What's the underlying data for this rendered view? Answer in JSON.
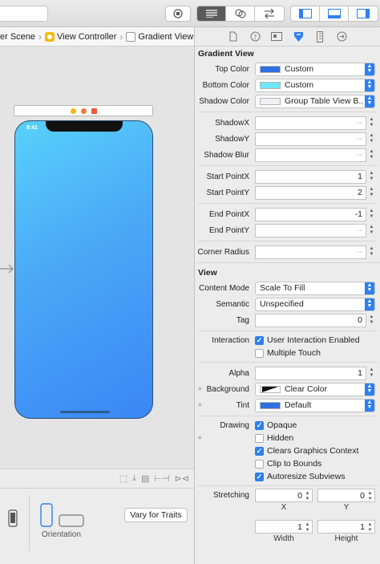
{
  "breadcrumb": {
    "scene": "er Scene",
    "view_controller": "View Controller",
    "view": "Gradient View"
  },
  "device": {
    "time": "9:41"
  },
  "device_bar": {
    "orientation_label": "Orientation",
    "vary_button": "Vary for Traits"
  },
  "gradient_view": {
    "title": "Gradient View",
    "top_color": {
      "label": "Top Color",
      "value": "Custom",
      "swatch": "#2f6fe0"
    },
    "bottom_color": {
      "label": "Bottom Color",
      "value": "Custom",
      "swatch": "#6fe6f6"
    },
    "shadow_color": {
      "label": "Shadow Color",
      "value": "Group Table View B...",
      "swatch": "#efeff4"
    },
    "shadow_x": {
      "label": "ShadowX",
      "value": "--"
    },
    "shadow_y": {
      "label": "ShadowY",
      "value": "--"
    },
    "shadow_blur": {
      "label": "Shadow Blur",
      "value": "--"
    },
    "start_x": {
      "label": "Start PointX",
      "value": "1"
    },
    "start_y": {
      "label": "Start PointY",
      "value": "2"
    },
    "end_x": {
      "label": "End PointX",
      "value": "-1"
    },
    "end_y": {
      "label": "End PointY",
      "value": "--"
    },
    "corner_radius": {
      "label": "Corner Radius",
      "value": "--"
    }
  },
  "view": {
    "title": "View",
    "content_mode": {
      "label": "Content Mode",
      "value": "Scale To Fill"
    },
    "semantic": {
      "label": "Semantic",
      "value": "Unspecified"
    },
    "tag": {
      "label": "Tag",
      "value": "0"
    },
    "interaction": {
      "label": "Interaction",
      "user_interaction": {
        "text": "User Interaction Enabled",
        "checked": true
      },
      "multiple_touch": {
        "text": "Multiple Touch",
        "checked": false
      }
    },
    "alpha": {
      "label": "Alpha",
      "value": "1"
    },
    "background": {
      "label": "Background",
      "value": "Clear Color"
    },
    "tint": {
      "label": "Tint",
      "value": "Default",
      "swatch": "#2f6fe0"
    },
    "drawing": {
      "label": "Drawing",
      "opaque": {
        "text": "Opaque",
        "checked": true
      },
      "hidden": {
        "text": "Hidden",
        "checked": false
      },
      "clears": {
        "text": "Clears Graphics Context",
        "checked": true
      },
      "clip": {
        "text": "Clip to Bounds",
        "checked": false
      },
      "autoresize": {
        "text": "Autoresize Subviews",
        "checked": true
      }
    },
    "stretching": {
      "label": "Stretching",
      "x": "0",
      "y": "0",
      "width": "1",
      "height": "1",
      "x_label": "X",
      "y_label": "Y",
      "width_label": "Width",
      "height_label": "Height"
    }
  },
  "colors": {
    "accent": "#2e80ef",
    "gradient_start": "#58d1fb",
    "gradient_end": "#3b86f5"
  }
}
